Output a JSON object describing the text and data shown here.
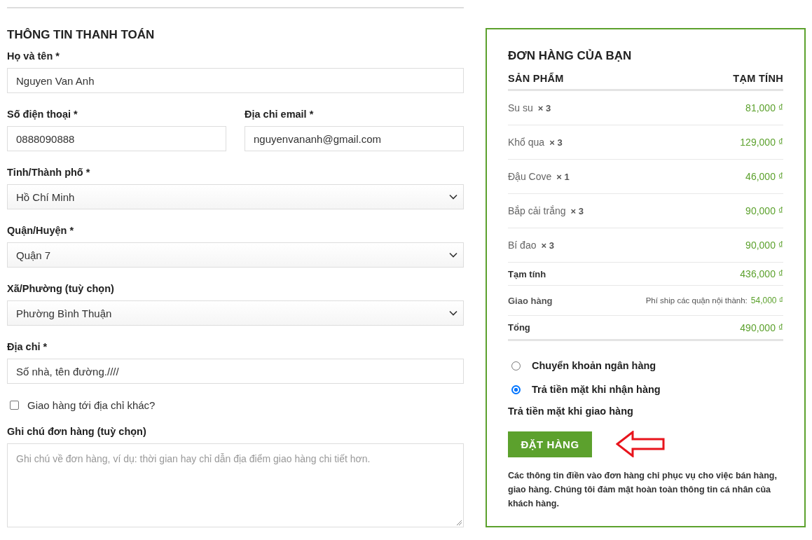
{
  "billing": {
    "title": "THÔNG TIN THANH TOÁN",
    "fields": [
      {
        "kind": "text",
        "label": "Họ và tên *",
        "value": "Nguyen Van Anh"
      },
      {
        "kind": "pair",
        "fields": [
          {
            "label": "Số điện thoại *",
            "value": "0888090888"
          },
          {
            "label": "Địa chỉ email *",
            "value": "nguyenvananh@gmail.com"
          }
        ]
      },
      {
        "kind": "select",
        "label": "Tỉnh/Thành phố *",
        "value": "Hồ Chí Minh"
      },
      {
        "kind": "select",
        "label": "Quận/Huyện *",
        "value": "Quận 7"
      },
      {
        "kind": "select",
        "label": "Xã/Phường (tuỳ chọn)",
        "value": "Phường Bình Thuận"
      },
      {
        "kind": "text",
        "label": "Địa chỉ *",
        "value": "Số nhà, tên đường.////"
      },
      {
        "kind": "checkbox",
        "label": "Giao hàng tới địa chỉ khác?",
        "checked": false
      },
      {
        "kind": "textarea",
        "label": "Ghi chú đơn hàng (tuỳ chọn)",
        "placeholder": "Ghi chú về đơn hàng, ví dụ: thời gian hay chỉ dẫn địa điểm giao hàng chi tiết hơn."
      }
    ]
  },
  "order": {
    "title": "ĐƠN HÀNG CỦA BẠN",
    "columns": [
      "SẢN PHẨM",
      "TẠM TÍNH"
    ],
    "items": [
      {
        "name": "Su su",
        "qty": "× 3",
        "price": "81,000 ₫"
      },
      {
        "name": "Khổ qua",
        "qty": "× 3",
        "price": "129,000 ₫"
      },
      {
        "name": "Đậu Cove",
        "qty": "× 1",
        "price": "46,000 ₫"
      },
      {
        "name": "Bắp cải trắng",
        "qty": "× 3",
        "price": "90,000 ₫"
      },
      {
        "name": "Bí đao",
        "qty": "× 3",
        "price": "90,000 ₫"
      }
    ],
    "totals": [
      {
        "kind": "subtotal",
        "label": "Tạm tính",
        "price": "436,000 ₫"
      },
      {
        "kind": "shipping",
        "label": "Giao hàng",
        "note": "Phí ship các quận nội thành:",
        "price": "54,000 ₫"
      },
      {
        "kind": "total",
        "label": "Tổng",
        "price": "490,000 ₫"
      }
    ],
    "payment_methods": [
      {
        "label": "Chuyển khoản ngân hàng",
        "selected": false
      },
      {
        "label": "Trả tiền mặt khi nhận hàng",
        "selected": true
      }
    ],
    "payment_note": "Trả tiền mặt khi giao hàng",
    "submit": "ĐẶT HÀNG",
    "privacy": "Các thông tin điền vào đơn hàng chỉ phục vụ cho việc bán hàng, giao hàng. Chúng tôi đảm mật hoàn toàn thông tin cá nhân của khách hàng."
  }
}
